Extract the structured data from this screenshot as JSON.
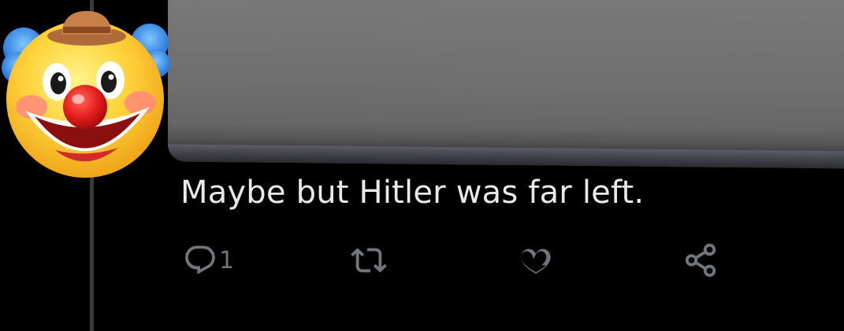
{
  "post": {
    "text": "Maybe but Hitler was far left."
  },
  "avatar": {
    "icon": "clown-face-avatar"
  },
  "actions": {
    "reply_count": "1",
    "reply_icon": "reply-icon",
    "repost_icon": "repost-icon",
    "like_icon": "heart-icon",
    "share_icon": "share-icon"
  },
  "colors": {
    "background": "#000000",
    "text": "#e7e9ea",
    "muted": "#71767b",
    "thread_line": "#3a3a3d"
  }
}
